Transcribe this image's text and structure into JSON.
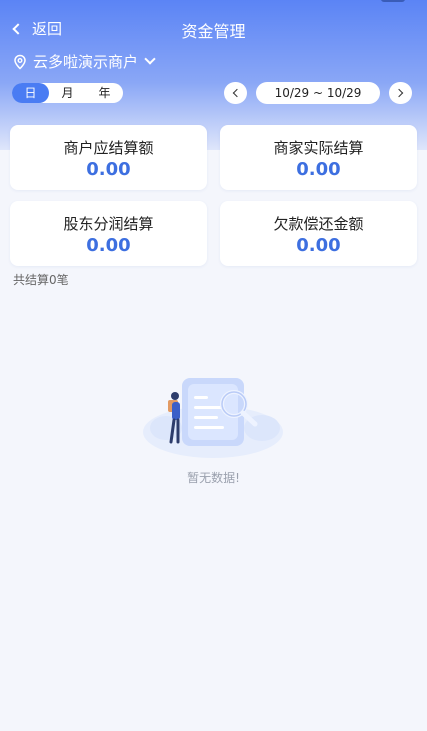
{
  "header": {
    "back_label": "返回",
    "title": "资金管理",
    "merchant_name": "云多啦演示商户"
  },
  "period_tabs": [
    {
      "label": "日",
      "active": true
    },
    {
      "label": "月",
      "active": false
    },
    {
      "label": "年",
      "active": false
    }
  ],
  "date_range": "10/29 ~ 10/29",
  "summary": [
    {
      "label": "商户应结算额",
      "value": "0.00"
    },
    {
      "label": "商家实际结算",
      "value": "0.00"
    },
    {
      "label": "股东分润结算",
      "value": "0.00"
    },
    {
      "label": "欠款偿还金额",
      "value": "0.00"
    }
  ],
  "settlement_count_text": "共结算0笔",
  "empty_state": {
    "text": "暂无数据!"
  },
  "colors": {
    "primary": "#4a7cf3",
    "value_text": "#3d6fe0",
    "header_top": "#5b84f5"
  }
}
